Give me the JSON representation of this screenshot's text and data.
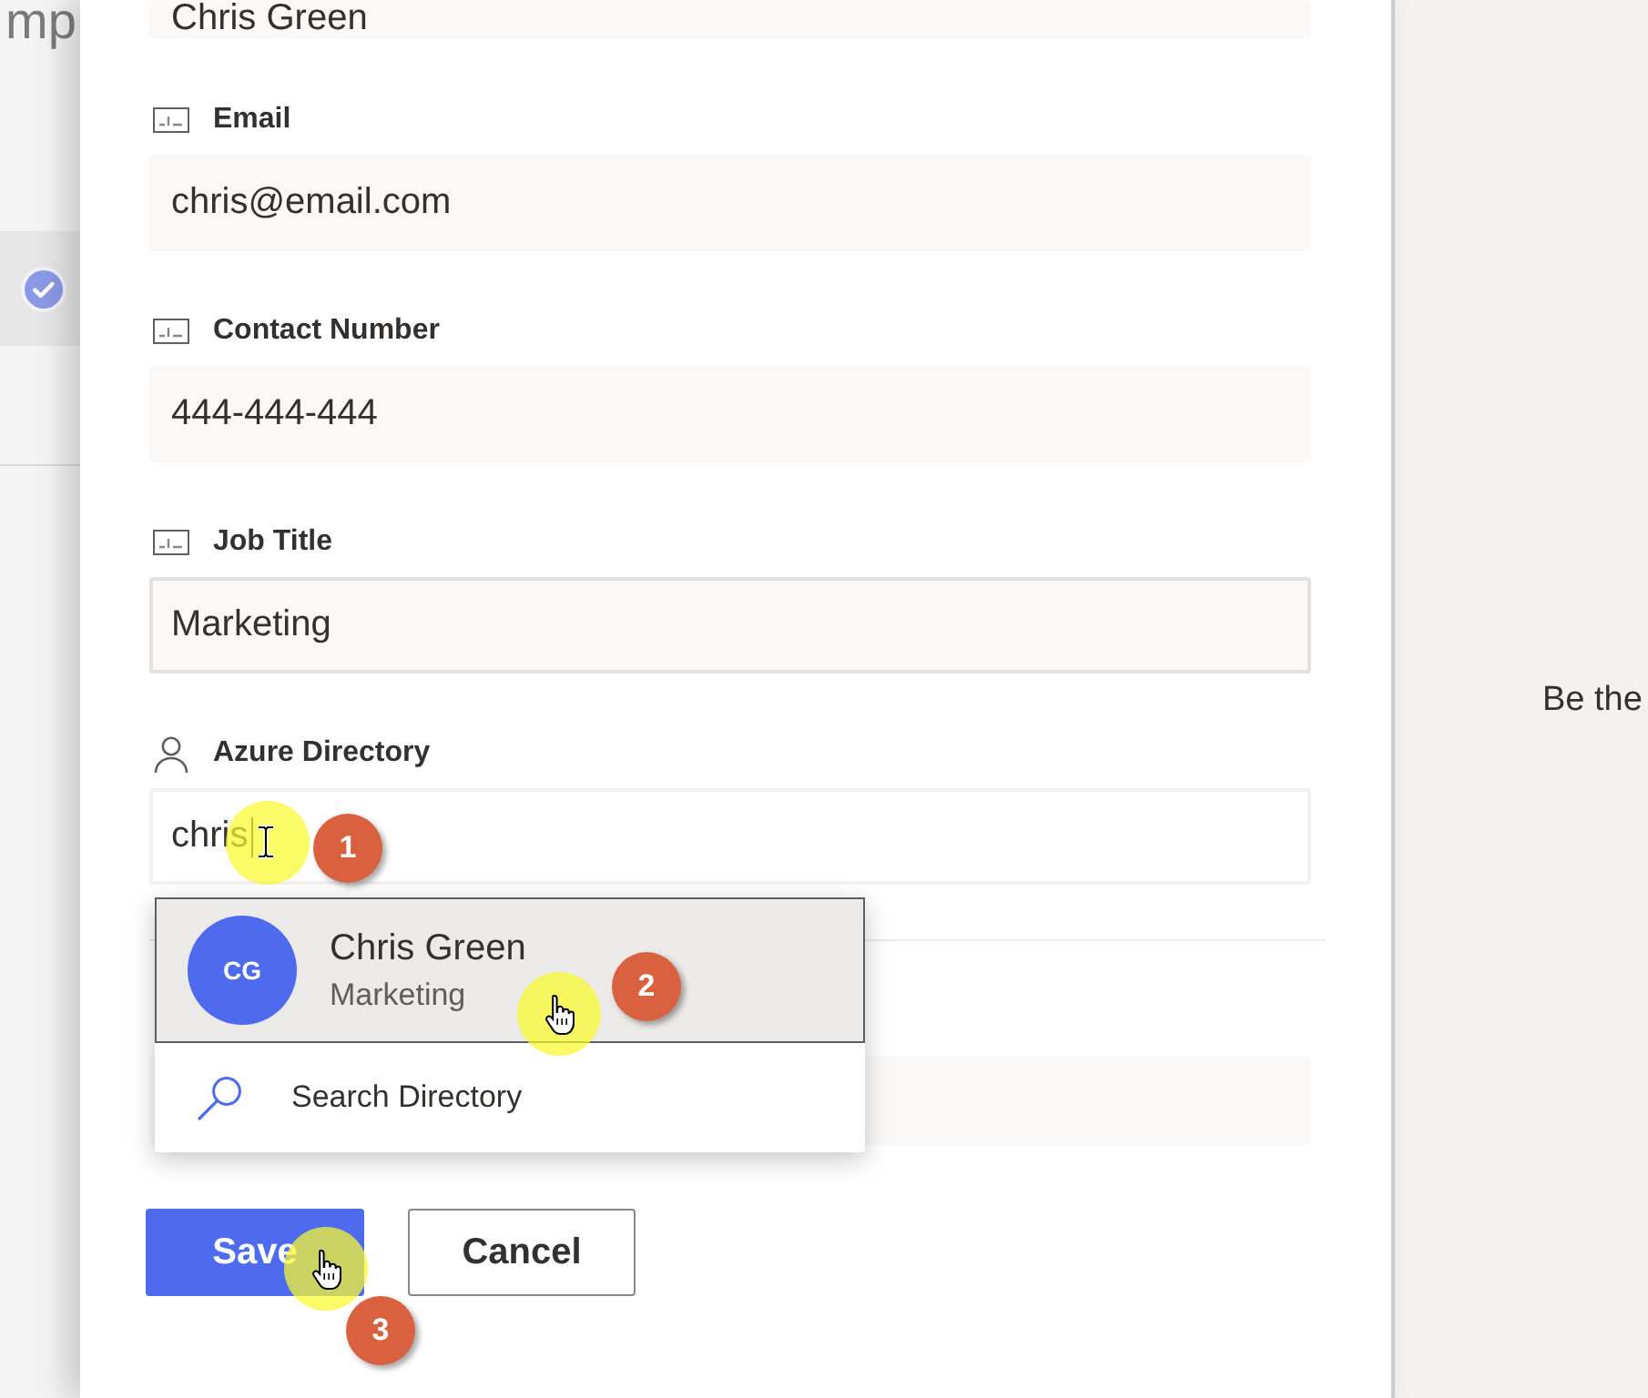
{
  "background": {
    "title": "mp",
    "rows": [
      {
        "selected": true
      },
      {
        "selected": false
      }
    ]
  },
  "form": {
    "fields": [
      {
        "kind": "text",
        "value": "Chris Green",
        "focused": false,
        "hovered": false
      },
      {
        "kind": "text",
        "label": "Email",
        "value": "chris@email.com",
        "focused": false,
        "hovered": false
      },
      {
        "kind": "text",
        "label": "Contact Number",
        "value": "444-444-444",
        "focused": false,
        "hovered": false
      },
      {
        "kind": "text",
        "label": "Job Title",
        "value": "Marketing",
        "focused": false,
        "hovered": true
      },
      {
        "kind": "people",
        "label": "Azure Directory",
        "value": "chris",
        "focused": true,
        "hovered": false
      },
      {
        "kind": "text"
      }
    ],
    "people_suggestions": {
      "items": [
        {
          "initials": "CG",
          "name": "Chris Green",
          "subtitle": "Marketing",
          "selected": true
        }
      ],
      "search_action": "Search Directory"
    },
    "buttons": [
      {
        "label": "Save",
        "kind": "primary"
      },
      {
        "label": "Cancel",
        "kind": "default"
      }
    ]
  },
  "side_panel": {
    "text": "Be the"
  },
  "annotations": [
    {
      "number": "1",
      "kind": "text"
    },
    {
      "number": "2",
      "kind": "hand"
    },
    {
      "number": "3",
      "kind": "hand"
    }
  ]
}
